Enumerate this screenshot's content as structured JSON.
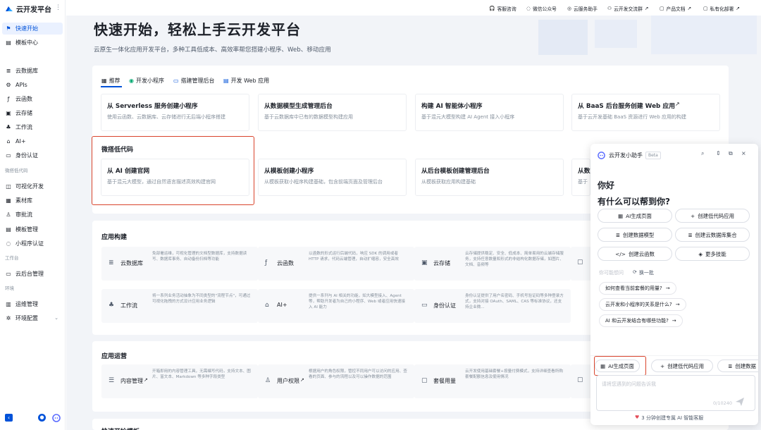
{
  "brand": {
    "name": "云开发平台"
  },
  "sidebar": {
    "items": [
      {
        "label": "快速开始",
        "icon": "flag-icon"
      },
      {
        "label": "模板中心",
        "icon": "template-icon"
      },
      {
        "label": "云数据库",
        "icon": "database-icon"
      },
      {
        "label": "APIs",
        "icon": "api-icon"
      },
      {
        "label": "云函数",
        "icon": "function-icon"
      },
      {
        "label": "云存储",
        "icon": "storage-icon"
      },
      {
        "label": "工作流",
        "icon": "workflow-icon"
      },
      {
        "label": "AI+",
        "icon": "robot-icon"
      },
      {
        "label": "身份认证",
        "icon": "id-card-icon"
      },
      {
        "label": "可视化开发",
        "icon": "visual-dev-icon"
      },
      {
        "label": "素材库",
        "icon": "asset-icon"
      },
      {
        "label": "审批流",
        "icon": "approval-icon"
      },
      {
        "label": "模板管理",
        "icon": "template-manage-icon"
      },
      {
        "label": "小程序认证",
        "icon": "miniprogram-icon"
      },
      {
        "label": "云后台管理",
        "icon": "monitor-icon"
      },
      {
        "label": "运维管理",
        "icon": "ops-icon"
      },
      {
        "label": "环境配置",
        "icon": "gear-icon"
      }
    ],
    "sections": [
      "微搭低代码",
      "工作台",
      "环境"
    ]
  },
  "toplinks": [
    "客服咨询",
    "微信公众号",
    "云服务助手",
    "云开发交流群",
    "产品文档",
    "私有化部署"
  ],
  "hero": {
    "title": "快速开始，轻松上手云开发平台",
    "subtitle": "云原生一体化应用开发平台，多种工具低成本、高效率帮您搭建小程序、Web、移动应用"
  },
  "tabs": [
    "推荐",
    "开发小程序",
    "搭建管理后台",
    "开发 Web 应用"
  ],
  "cards_row1": [
    {
      "title": "从 Serverless 服务创建小程序",
      "desc": "使用云函数、云数据库、云存储进行无后端小程序搭建"
    },
    {
      "title": "从数据模型生成管理后台",
      "desc": "基于云数据库中已有的数据模型构建应用"
    },
    {
      "title": "构建 AI 智能体小程序",
      "desc": "基于混元大模型构建 AI Agent 接入小程序"
    },
    {
      "title": "从 BaaS 后台服务创建 Web 应用",
      "desc": "基于云开发基础 BaaS 资源进行 Web 应用的构建"
    }
  ],
  "lowcode_section": "微搭低代码",
  "cards_row2": [
    {
      "title": "从 AI 创建官网",
      "desc": "基于混元大模型，通过自然语言描述高效构建官网"
    },
    {
      "title": "从模板创建小程序",
      "desc": "从模板获取小程序构建基础，包含前端页面及管理后台"
    },
    {
      "title": "从后台模板创建管理后台",
      "desc": "从模板获取应用构建基础"
    },
    {
      "title": "从数",
      "desc": "基于"
    }
  ],
  "build_section": "应用构建",
  "build_features": [
    {
      "name": "云数据库",
      "icon": "database-icon",
      "desc": "免部署运维，可视化管理的文档型数据库，支持数据读写、数据库事务、自动备份扫档等功能"
    },
    {
      "name": "云函数",
      "icon": "function-icon",
      "desc": "以函数的形式运行后端代码，响应 SDK 的调用或者 HTTP 请求，代码云端管理，自动扩缩容，安全高效"
    },
    {
      "name": "云存储",
      "icon": "storage-icon",
      "desc": "云存储提供稳定、安全、低成本、简单易用的云端存储服务，支持任意数量和形式的非结构化数据存储，如图片、文档、音频等"
    },
    {
      "name": "工作流",
      "icon": "workflow-icon",
      "desc": "将一系列业务活动抽象为不同类型的\"流程节点\"，可通过可视化拖拽的方式设计应用业务逻辑"
    },
    {
      "name": "AI+",
      "icon": "robot-icon",
      "desc": "提供一系列与 AI 相关的功能，如大模型接入、Agent 等，帮助开发者为自己的小程序、Web 或者应用快速接入 AI 能力"
    },
    {
      "name": "身份认证",
      "icon": "id-card-icon",
      "desc": "身份认证提供了用户名密码、手机号验证码等多种登录方式，支持对接 OAuth、SAML、CAS 等标准协议，还支持企业微..."
    }
  ],
  "ops_section": "应用运营",
  "ops_features": [
    {
      "name": "内容管理",
      "icon": "content-icon",
      "desc": "开箱即用的内容管理工具，无需编写代码，支持文本、图片、富文本、Markdown 等多种字段类型"
    },
    {
      "name": "用户权限",
      "icon": "user-permission-icon",
      "desc": "根据用户的角色权限，管控不同用户可以访问的应用、查看的页面、参与的流程以及可以操作数据的范围"
    },
    {
      "name": "套餐用量",
      "icon": "package-icon",
      "desc": "云开发使用基础套餐+按量付费模式，支持详细查看所购套餐配额信息及使用情况"
    }
  ],
  "bottom_section": "快速开始模板",
  "assistant": {
    "title": "云开发小助手",
    "badge": "Beta",
    "greeting": "你好",
    "question": "有什么可以帮到你?",
    "actions": [
      {
        "label": "AI生成页面",
        "icon": "grid-icon"
      },
      {
        "label": "创建低代码应用",
        "icon": "plus-icon"
      },
      {
        "label": "创建数据模型",
        "icon": "database-icon"
      },
      {
        "label": "创建云数据库集合",
        "icon": "database-icon"
      },
      {
        "label": "创建云函数",
        "icon": "code-icon"
      },
      {
        "label": "更多技能",
        "icon": "box-icon"
      }
    ],
    "suggest_label": "你可能想问",
    "refresh_label": "换一批",
    "questions": [
      "如何查看当前套餐的用量?",
      "云开发和小程序的关系是什么?",
      "AI 和云开发结合有哪些功能?"
    ],
    "bottom_chips": [
      "AI生成页面",
      "创建低代码应用",
      "创建数据"
    ],
    "input_placeholder": "请将您遇到的问题告诉我",
    "counter": "0/10240",
    "footer": "3 分钟创建专属 AI 智能客服"
  }
}
